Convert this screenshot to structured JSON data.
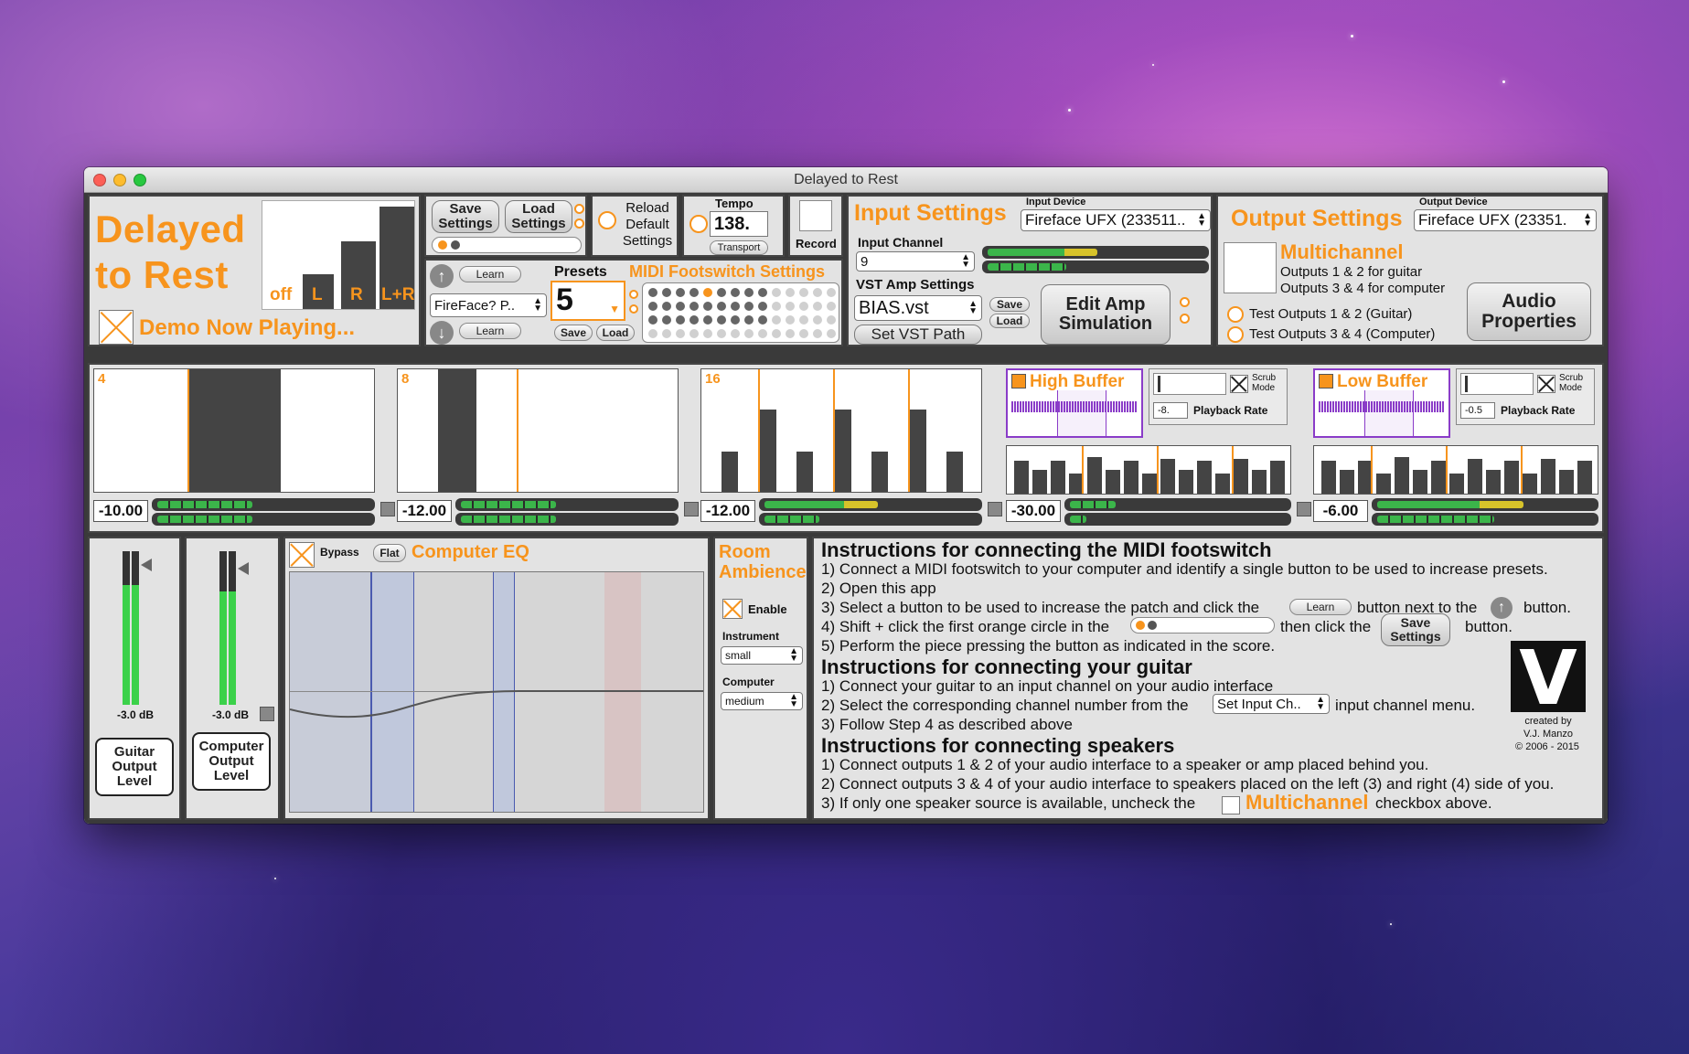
{
  "window": {
    "title": "Delayed to Rest"
  },
  "header": {
    "app_title_line1": "Delayed",
    "app_title_line2": "to Rest",
    "demo_label": "Demo Now Playing...",
    "routing": [
      "off",
      "L",
      "R",
      "L+R"
    ]
  },
  "settings": {
    "save_label": "Save Settings",
    "load_label": "Load Settings",
    "reload_label": "Reload Default Settings"
  },
  "tempo": {
    "label": "Tempo",
    "value": "138.",
    "transport_label": "Transport"
  },
  "record": {
    "label": "Record"
  },
  "midi": {
    "learn_label": "Learn",
    "device_value": "FireFace? P..",
    "presets_label": "Presets",
    "preset_value": "5",
    "save_label": "Save",
    "load_label": "Load",
    "title": "MIDI Footswitch Settings"
  },
  "input": {
    "title": "Input Settings",
    "device_label": "Input Device",
    "device_value": "Fireface UFX (233511..",
    "channel_label": "Input Channel",
    "channel_value": "9",
    "vst_label": "VST Amp Settings",
    "vst_value": "BIAS.vst",
    "vst_save": "Save",
    "vst_load": "Load",
    "edit_amp_label": "Edit Amp Simulation",
    "set_vst_label": "Set VST Path"
  },
  "output": {
    "title": "Output Settings",
    "device_label": "Output Device",
    "device_value": "Fireface UFX (23351.",
    "multichannel_label": "Multichannel",
    "multi_desc1": "Outputs 1 & 2 for guitar",
    "multi_desc2": "Outputs 3 & 4 for computer",
    "test12_label": "Test Outputs 1 & 2 (Guitar)",
    "test34_label": "Test Outputs 3 & 4 (Computer)",
    "audio_props_label": "Audio Properties"
  },
  "delays": [
    {
      "division": "4",
      "db": "-10.00"
    },
    {
      "division": "8",
      "db": "-12.00"
    },
    {
      "division": "16",
      "db": "-12.00"
    }
  ],
  "buffers": [
    {
      "title": "High Buffer",
      "scrub_label": "Scrub Mode",
      "rate_value": "-8.",
      "rate_label": "Playback Rate",
      "db": "-30.00"
    },
    {
      "title": "Low Buffer",
      "scrub_label": "Scrub Mode",
      "rate_value": "-0.5",
      "rate_label": "Playback Rate",
      "db": "-6.00"
    }
  ],
  "levels": {
    "guitar_db": "-3.0 dB",
    "guitar_label": "Guitar Output Level",
    "computer_db": "-3.0 dB",
    "computer_label": "Computer Output Level",
    "guitar_level_fraction": 0.78,
    "computer_level_fraction": 0.74
  },
  "eq": {
    "bypass_label": "Bypass",
    "flat_label": "Flat",
    "title": "Computer EQ"
  },
  "ambience": {
    "title": "Room Ambience",
    "enable_label": "Enable",
    "instrument_label": "Instrument",
    "instrument_value": "small",
    "computer_label": "Computer",
    "computer_value": "medium"
  },
  "instructions": {
    "midi_title": "Instructions for connecting the MIDI footswitch",
    "midi_1": "1) Connect a MIDI footswitch to your computer and identify a single button to be used to increase presets.",
    "midi_2": "2) Open this app",
    "midi_3a": "3) Select a button to be used to increase the patch and click the",
    "midi_3_learn": "Learn",
    "midi_3b": "button next to the",
    "midi_3c": "button.",
    "midi_4a": "4) Shift + click the first orange circle in the",
    "midi_4b": "then click the",
    "midi_4_save": "Save Settings",
    "midi_4c": "button.",
    "midi_5": "5) Perform the piece pressing the button as indicated in the score.",
    "guitar_title": "Instructions for connecting your guitar",
    "guitar_1": "1) Connect your guitar to an input channel on your audio interface",
    "guitar_2a": "2) Select the corresponding channel number from the",
    "guitar_2_menu": "Set Input Ch..",
    "guitar_2b": "input channel menu.",
    "guitar_3": "3) Follow Step 4 as described above",
    "speakers_title": "Instructions for connecting speakers",
    "speakers_1": "1) Connect outputs 1 & 2 of your audio interface to a speaker or amp placed behind you.",
    "speakers_2": "2) Connect outputs 3 & 4 of your audio interface to speakers placed on the left (3) and right (4) side of you.",
    "speakers_3a": "3) If only one speaker source is available, uncheck the",
    "speakers_3_multi": "Multichannel",
    "speakers_3b": "checkbox above.",
    "credit_1": "created by",
    "credit_2": "V.J. Manzo",
    "credit_3": "© 2006 - 2015",
    "logo_letter": "V"
  }
}
